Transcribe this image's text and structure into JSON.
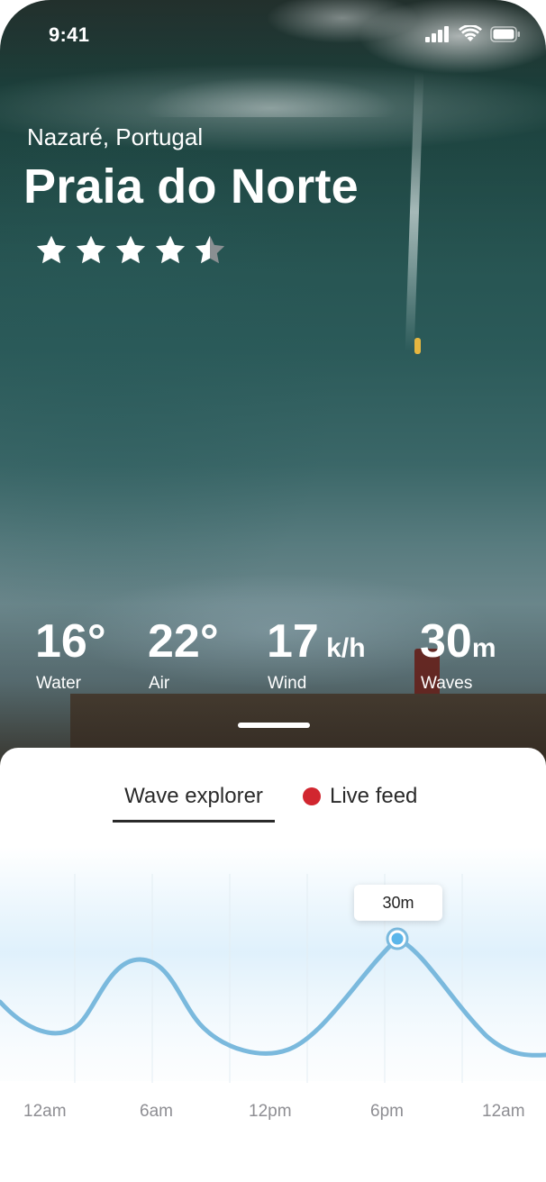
{
  "status": {
    "time": "9:41"
  },
  "location": "Nazaré, Portugal",
  "spot_name": "Praia do Norte",
  "rating": 4.5,
  "stats": [
    {
      "value": "16°",
      "unit": "",
      "label": "Water"
    },
    {
      "value": "22°",
      "unit": "",
      "label": "Air"
    },
    {
      "value": "17",
      "unit": " k/h",
      "label": "Wind"
    },
    {
      "value": "30",
      "unit": "m",
      "label": "Waves"
    }
  ],
  "tabs": {
    "wave_explorer": "Wave explorer",
    "live_feed": "Live feed"
  },
  "colors": {
    "accent": "#7ab9dd",
    "live": "#d1262f"
  },
  "chart_data": {
    "type": "line",
    "x_labels": [
      "12am",
      "6am",
      "12pm",
      "6pm",
      "12am"
    ],
    "tooltip": "30m",
    "peak_value": 30
  }
}
